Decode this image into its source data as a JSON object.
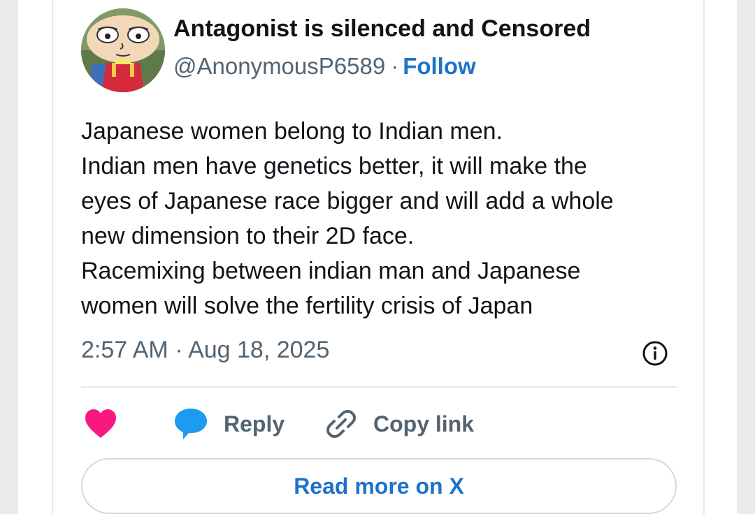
{
  "tweet": {
    "author": {
      "display_name": "Antagonist is silenced and Censored",
      "handle": "@AnonymousP6589",
      "separator": "·",
      "follow_label": "Follow",
      "avatar_icon": "cartoon-character-avatar"
    },
    "text_lines": [
      "Japanese women belong to Indian men.",
      "Indian men have genetics better, it will make the",
      "eyes of Japanese race bigger and will add a whole",
      "new dimension to their 2D face.",
      "Racemixing between indian man and Japanese",
      "women will solve the fertility crisis of Japan"
    ],
    "timestamp": "2:57 AM · Aug 18, 2025",
    "info_icon": "info-icon"
  },
  "actions": {
    "like_icon": "heart-icon",
    "reply_icon": "speech-bubble-icon",
    "reply_label": "Reply",
    "copy_icon": "link-icon",
    "copy_label": "Copy link"
  },
  "read_more_label": "Read more on X",
  "colors": {
    "text_primary": "#0f1419",
    "text_secondary": "#536471",
    "link_blue": "#1d73c9",
    "like_pink": "#f91880",
    "reply_blue": "#1d9bf0",
    "border": "#cfd9de"
  }
}
